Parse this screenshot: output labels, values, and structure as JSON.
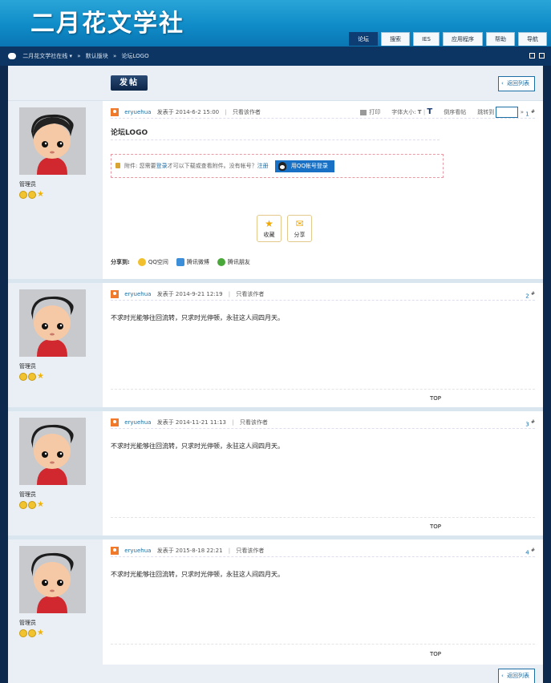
{
  "header": {
    "logo_text": "二月花文学社",
    "nav": [
      {
        "label": "论坛",
        "active": true
      },
      {
        "label": "搜索"
      },
      {
        "label": "IES"
      },
      {
        "label": "应用程序"
      },
      {
        "label": "帮助"
      },
      {
        "label": "导航"
      }
    ]
  },
  "breadcrumb": {
    "site": "二月花文学社在线",
    "dropdown": "▾",
    "sep": "»",
    "forum": "默认版块",
    "thread": "论坛LOGO"
  },
  "toolbar": {
    "post_label": "发帖",
    "back_label": "返回列表"
  },
  "thread_tools": {
    "print": "打印",
    "font_size": "字体大小:",
    "font_small": "T",
    "font_large": "T",
    "reverse": "倒序看帖",
    "jump": "跳转到",
    "next": "»"
  },
  "posts": [
    {
      "author": "eryuehua",
      "posted": "发表于 2014-6-2 15:00",
      "only_author": "只看该作者",
      "floor": "1",
      "role": "管理员",
      "title": "论坛LOGO",
      "attach_text": "附件: 您需要",
      "attach_login": "登录",
      "attach_text2": "才可以下载或查看附件。没有帐号？",
      "attach_register": "注册",
      "qq_login": "用QQ帐号登录",
      "favorite": "收藏",
      "share": "分享",
      "share_to": "分享到:",
      "share_qzone": "QQ空间",
      "share_weibo": "腾讯微博",
      "share_friends": "腾讯朋友"
    },
    {
      "author": "eryuehua",
      "posted": "发表于 2014-9-21 12:19",
      "only_author": "只看该作者",
      "floor": "2",
      "role": "管理员",
      "body": "不求时光能够往回流转，只求时光停顿，永驻这人间四月天。",
      "top": "TOP"
    },
    {
      "author": "eryuehua",
      "posted": "发表于 2014-11-21 11:13",
      "only_author": "只看该作者",
      "floor": "3",
      "role": "管理员",
      "body": "不求时光能够往回流转，只求时光停顿，永驻这人间四月天。",
      "top": "TOP"
    },
    {
      "author": "eryuehua",
      "posted": "发表于 2015-8-18 22:21",
      "only_author": "只看该作者",
      "floor": "4",
      "role": "管理员",
      "body": "不求时光能够往回流转，只求时光停顿，永驻这人间四月天。",
      "top": "TOP"
    }
  ],
  "floor_mark": "#",
  "colors": {
    "header_blue": "#0f8cc8",
    "nav_dark": "#0d3563",
    "link": "#1c6ea4",
    "qq_button": "#1871c4"
  }
}
